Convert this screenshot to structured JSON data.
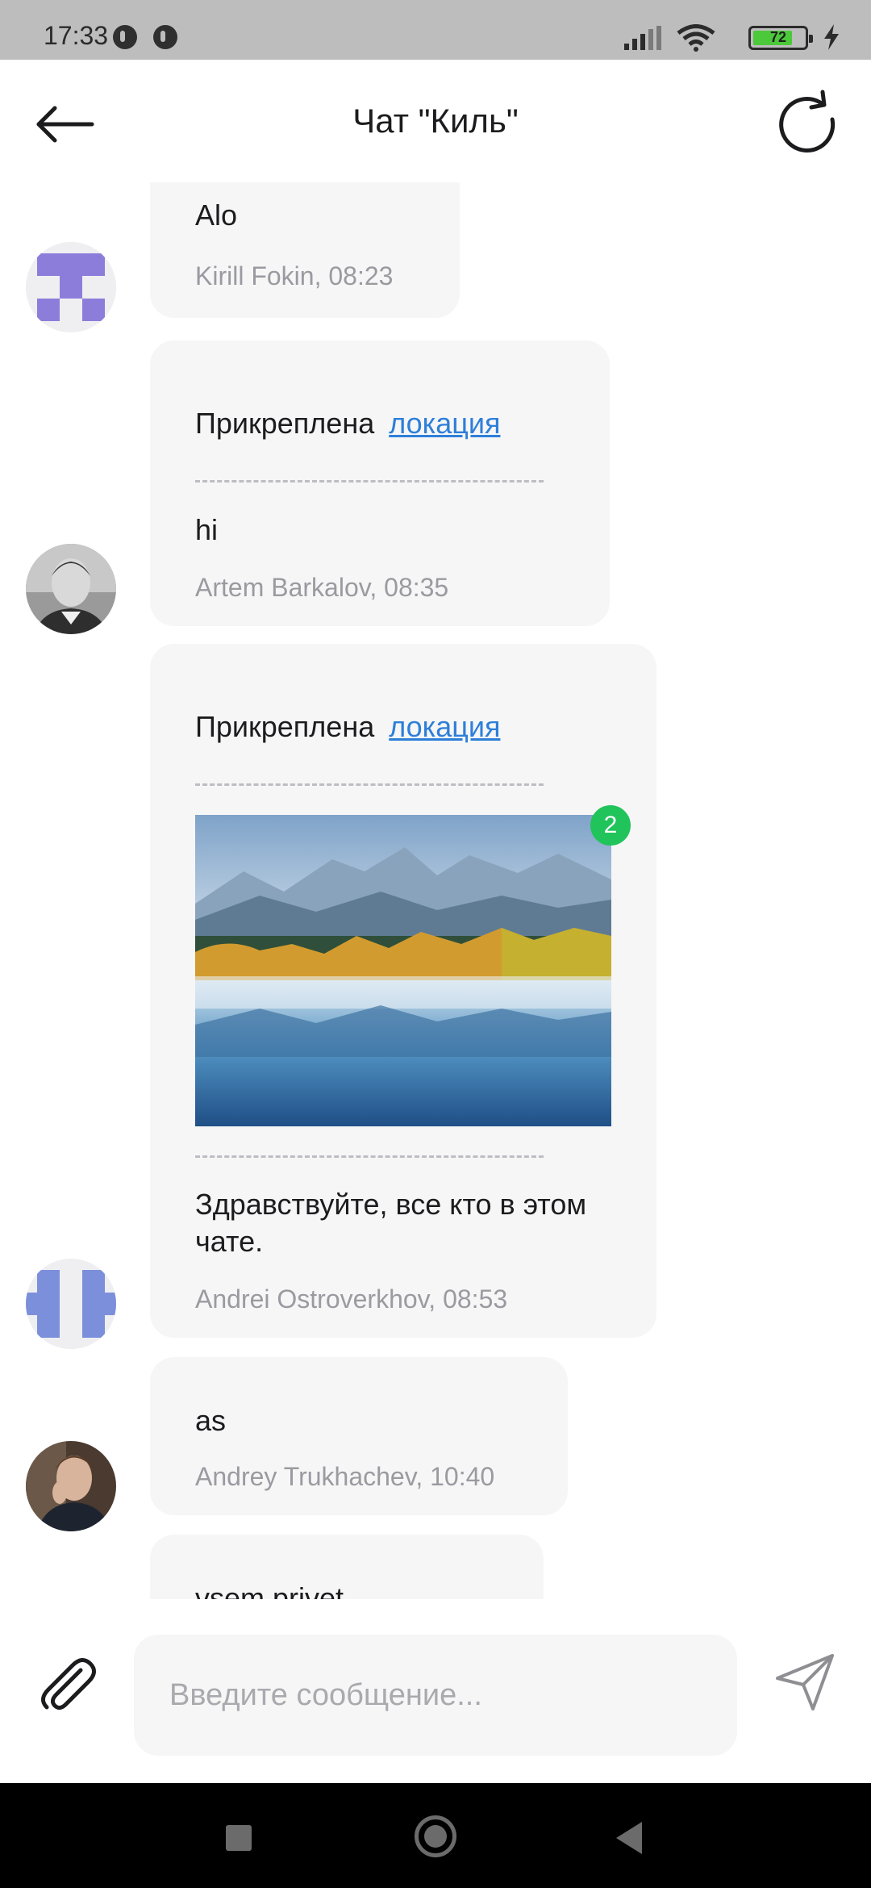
{
  "status_bar": {
    "time": "17:33",
    "battery_level": "72",
    "battery_color": "#4bc93a",
    "icons": [
      "app-notification-icon",
      "app-notification-icon",
      "signal-icon",
      "wifi-icon",
      "battery-icon",
      "charging-icon"
    ]
  },
  "header": {
    "title": "Чат \"Киль\"",
    "back_icon": "arrow-left-icon",
    "refresh_icon": "refresh-icon"
  },
  "messages": [
    {
      "text": "Alo",
      "meta": "Kirill Fokin, 08:23",
      "avatar": "identicon-purple"
    },
    {
      "attachment_prefix": "Прикреплена",
      "attachment_link": "локация",
      "text": "hi",
      "meta": "Artem Barkalov, 08:35",
      "avatar": "photo-artem"
    },
    {
      "attachment_prefix": "Прикреплена",
      "attachment_link": "локация",
      "photo_count": "2",
      "text": "Здравствуйте, все кто в этом чате.",
      "meta": "Andrei Ostroverkhov, 08:53",
      "avatar": "identicon-blue"
    },
    {
      "text": "as",
      "meta": "Andrey Trukhachev, 10:40",
      "avatar": "photo-andrey"
    },
    {
      "text": "vsem privet"
    }
  ],
  "composer": {
    "placeholder": "Введите сообщение...",
    "attach_icon": "paperclip-icon",
    "send_icon": "send-icon"
  },
  "colors": {
    "bubble": "#f6f6f7",
    "link": "#2e7fd8",
    "badge": "#20c45a",
    "meta_text": "#9a9aa0"
  }
}
